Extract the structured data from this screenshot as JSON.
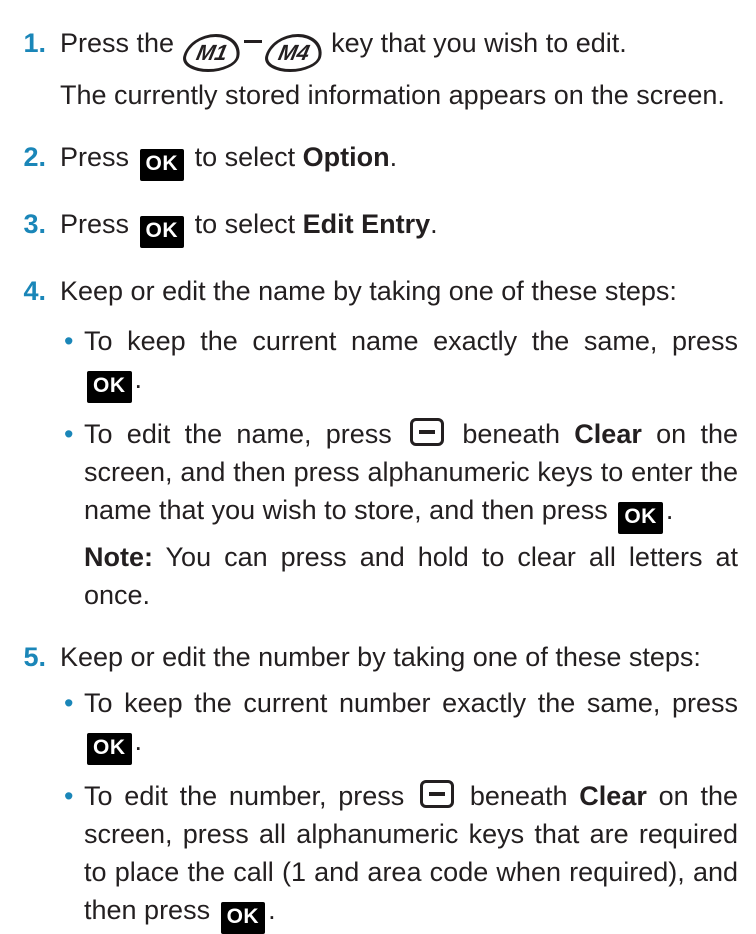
{
  "steps": [
    {
      "number": "1.",
      "press_prefix": "Press the",
      "key_m1": "M1",
      "key_m4": "M4",
      "press_suffix": "key that you wish to edit.",
      "detail": "The currently stored information appears on the screen."
    },
    {
      "number": "2.",
      "prefix": "Press",
      "ok": "OK",
      "middle": "to select",
      "bold": "Option",
      "end": "."
    },
    {
      "number": "3.",
      "prefix": "Press",
      "ok": "OK",
      "middle": "to select",
      "bold": "Edit Entry",
      "end": "."
    },
    {
      "number": "4.",
      "intro": "Keep or edit the name by taking one of these steps:",
      "bullet1": {
        "text": "To keep the current name exactly the same, press",
        "ok": "OK",
        "end": "."
      },
      "bullet2": {
        "a": "To edit the name, press",
        "b": "beneath",
        "clear": "Clear",
        "c": "on the screen, and then press alphanumeric keys to enter the name that you wish to store, and then press",
        "ok": "OK",
        "end": "."
      },
      "note_label": "Note:",
      "note_text": "You can press and hold to clear all letters at once."
    },
    {
      "number": "5.",
      "intro": "Keep or edit the number by taking one of these steps:",
      "bullet1": {
        "text": "To keep the current number exactly the same, press",
        "ok": "OK",
        "end": "."
      },
      "bullet2": {
        "a": "To edit the number, press",
        "b": "beneath",
        "clear": "Clear",
        "c": "on the screen, press all alphanumeric keys that are required to place the call (1 and area code when required), and then press",
        "ok": "OK",
        "end": "."
      }
    }
  ],
  "bullet_glyph": "•",
  "colors": {
    "accent": "#1a86b8",
    "text": "#231f20"
  }
}
